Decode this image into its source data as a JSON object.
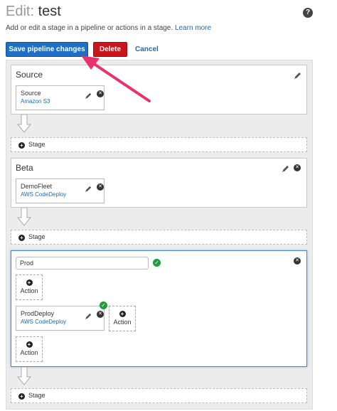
{
  "header": {
    "title_prefix": "Edit:",
    "title_name": "test",
    "help_glyph": "?",
    "subtitle": "Add or edit a stage in a pipeline or actions in a stage.",
    "learn_more": "Learn more"
  },
  "toolbar": {
    "save_label": "Save pipeline changes",
    "delete_label": "Delete",
    "cancel_label": "Cancel"
  },
  "stages": [
    {
      "title": "Source",
      "actions": [
        {
          "name": "Source",
          "provider": "Amazon S3"
        }
      ]
    },
    {
      "title": "Beta",
      "actions": [
        {
          "name": "DemoFleet",
          "provider": "AWS CodeDeploy"
        }
      ]
    },
    {
      "title_input_value": "Prod",
      "actions": [
        {
          "name": "ProdDeploy",
          "provider": "AWS CodeDeploy"
        }
      ]
    }
  ],
  "add_stage_label": "Stage",
  "add_action_label": "Action",
  "colors": {
    "primary": "#1f6fc5",
    "danger": "#c9151b",
    "link": "#1a6bb5",
    "success": "#1f9d3a",
    "annotation_arrow": "#e8336d"
  },
  "icons": {
    "edit": "pencil-icon",
    "remove": "close-circle-icon",
    "valid": "check-circle-icon",
    "add": "plus-circle-icon",
    "help": "help-icon"
  }
}
